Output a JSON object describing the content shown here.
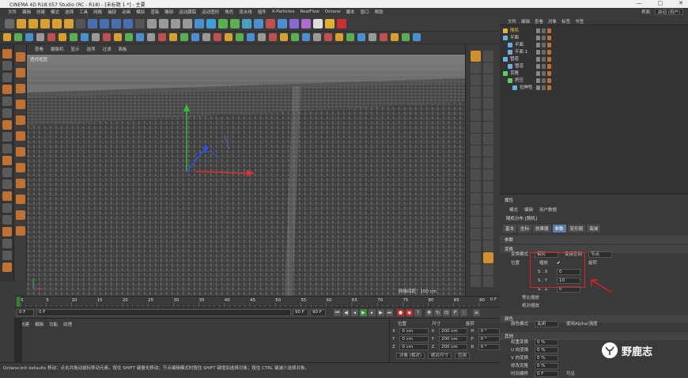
{
  "window": {
    "title": "CINEMA 4D R18.057 Studio (RC - R18) - [未标题 1 *] - 主要",
    "controls": [
      "—",
      "□",
      "✕"
    ]
  },
  "menubar": {
    "items": [
      "文件",
      "编辑",
      "创建",
      "模式",
      "选择",
      "工具",
      "网格",
      "捕捉",
      "动画",
      "模拟",
      "渲染",
      "雕刻",
      "运动跟踪",
      "运动图形",
      "角色",
      "流水线",
      "插件",
      "X-Particles",
      "RealFlow",
      "Octane",
      "脚本",
      "窗口",
      "帮助"
    ]
  },
  "layout": {
    "label": "界面",
    "value": "启动 (用户)"
  },
  "viewport": {
    "menu": [
      "查看",
      "摄像机",
      "显示",
      "选项",
      "过滤",
      "面板"
    ],
    "label": "透视视图",
    "grid_info": "网格间距：100 cm"
  },
  "timeline": {
    "ticks": [
      "0",
      "5",
      "10",
      "15",
      "20",
      "25",
      "30",
      "35",
      "40",
      "45",
      "50",
      "55",
      "60",
      "65",
      "70",
      "75",
      "80",
      "85",
      "90"
    ],
    "end_label": "0 F"
  },
  "transport": {
    "start": "0 F",
    "current": "0 F",
    "end": "90 F",
    "end2": "90 F"
  },
  "material_manager": {
    "menu": [
      "创建",
      "编辑",
      "功能",
      "纹理"
    ]
  },
  "coordinates": {
    "headers": [
      "位置",
      "尺寸",
      "旋转"
    ],
    "rows": [
      {
        "axis": "X",
        "pos": "0 cm",
        "size": "200 cm",
        "rot_axis": "H",
        "rot": "0 °"
      },
      {
        "axis": "Y",
        "pos": "0 cm",
        "size": "200 cm",
        "rot_axis": "P",
        "rot": "0 °"
      },
      {
        "axis": "Z",
        "pos": "0 cm",
        "size": "200 cm",
        "rot_axis": "B",
        "rot": "0 °"
      }
    ],
    "mode": "对象 (相对)",
    "size_mode": "绝对尺寸",
    "apply": "应用"
  },
  "status": "Octane:init defaults 移动：点击并拖动鼠标移动元素。按住 SHIFT 键量化移动；节点编辑模式时按住 SHIFT 键增加选择对象；按住 CTRL 键减少选择对象。",
  "object_manager": {
    "menu": [
      "文件",
      "编辑",
      "查看",
      "对象",
      "标签",
      "书签"
    ],
    "items": [
      {
        "name": "随机",
        "level": 0,
        "color": "#d8b73a"
      },
      {
        "name": "平面",
        "level": 0,
        "color": "#6ab0e0"
      },
      {
        "name": "平面",
        "level": 1,
        "color": "#6ab0e0"
      },
      {
        "name": "平面 1",
        "level": 1,
        "color": "#6ab0e0"
      },
      {
        "name": "管道",
        "level": 0,
        "color": "#6ab0e0"
      },
      {
        "name": "管道",
        "level": 1,
        "color": "#6ab0e0"
      },
      {
        "name": "克隆",
        "level": 0,
        "color": "#5ad06a"
      },
      {
        "name": "挤压",
        "level": 1,
        "color": "#5ad06a"
      },
      {
        "name": "拉伸性",
        "level": 2,
        "color": "#6ab0e0"
      }
    ]
  },
  "attributes": {
    "title": "属性",
    "menu": [
      "模式",
      "编辑",
      "用户数据"
    ],
    "object": "随机分布 [随机]",
    "tabs": [
      "基本",
      "坐标",
      "效果器",
      "参数",
      "变形器",
      "衰减"
    ],
    "active_tab": "参数",
    "section_label": "参数",
    "transform_header": "变换",
    "transform_mode_label": "变换模式",
    "transform_mode": "相对",
    "transform_space_label": "变换空间",
    "transform_space": "节点",
    "position_label": "位置",
    "scale_label": "缩放",
    "rotation_label": "旋转",
    "sx_label": "S . X",
    "sx": "0",
    "sy_label": "S . Y",
    "sy": "10",
    "sz_label": "S . Z",
    "sz": "0",
    "uniform_label": "等比缩放",
    "absolute_label": "绝对缩放",
    "color_header": "颜色",
    "color_mode_label": "颜色模式",
    "color_mode": "关闭",
    "use_alpha_label": "使用Alpha/强度",
    "other_header": "其他",
    "other_rows": [
      {
        "label": "权重变换",
        "value": "0 %"
      },
      {
        "label": "U 向变换",
        "value": "0 %"
      },
      {
        "label": "V 向变换",
        "value": "0 %"
      },
      {
        "label": "修改克隆",
        "value": "0 %"
      },
      {
        "label": "时间偏移",
        "value": "0 F"
      }
    ],
    "visible_label": "可见"
  },
  "watermark": {
    "text": "野鹿志"
  }
}
